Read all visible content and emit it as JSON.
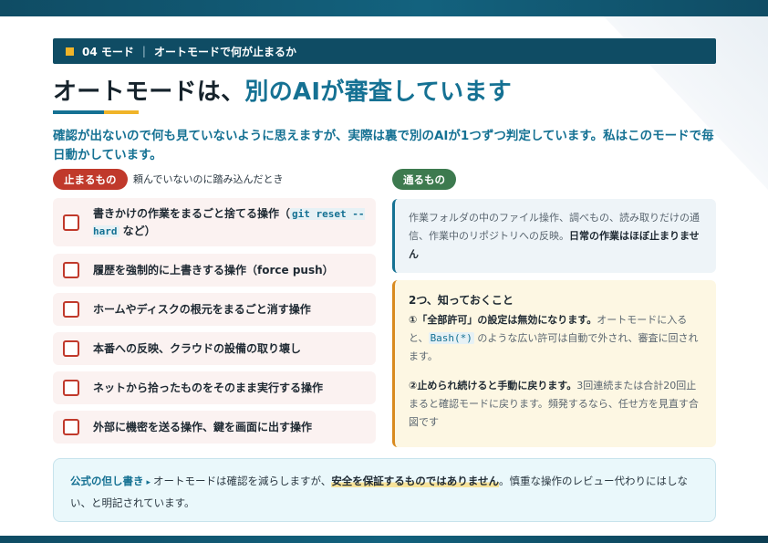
{
  "breadcrumb": {
    "section": "04 モード",
    "topic": "オートモードで何が止まるか"
  },
  "title": {
    "main": "オートモードは、",
    "accent": "別のAIが審査しています"
  },
  "lead": "確認が出ないので何も見ていないように思えますが、実際は裏で別のAIが1つずつ判定しています。私はこのモードで毎日動かしています。",
  "stop": {
    "label": "止まるもの",
    "note": "頼んでいないのに踏み込んだとき",
    "items": [
      {
        "text_before": "書きかけの作業をまるごと捨てる操作（",
        "code": "git reset --hard",
        "text_after": " など）"
      },
      {
        "text": "履歴を強制的に上書きする操作（force push）"
      },
      {
        "text": "ホームやディスクの根元をまるごと消す操作"
      },
      {
        "text": "本番への反映、クラウドの設備の取り壊し"
      },
      {
        "text": "ネットから拾ったものをそのまま実行する操作"
      },
      {
        "text": "外部に機密を送る操作、鍵を画面に出す操作"
      }
    ]
  },
  "pass": {
    "label": "通るもの",
    "body": "作業フォルダの中のファイル操作、調べもの、読み取りだけの通信、作業中のリポジトリへの反映。",
    "emphasis": "日常の作業はほぼ止まりません"
  },
  "notes": {
    "title": "2つ、知っておくこと",
    "n1_bold": "①「全部許可」の設定は無効になります。",
    "n1_text_a": "オートモードに入ると、",
    "n1_code": "Bash(*)",
    "n1_text_b": " のような広い許可は自動で外され、審査に回されます。",
    "n2_bold": "②止められ続けると手動に戻ります。",
    "n2_text": "3回連続または合計20回止まると確認モードに戻ります。頻発するなら、任せ方を見直す合図です"
  },
  "footer": {
    "label": "公式の但し書き",
    "arrow": "▸",
    "text_a": "オートモードは確認を減らしますが、",
    "emphasis": "安全を保証するものではありません",
    "text_b": "。慎重な操作のレビュー代わりにはしない、と明記されています。"
  },
  "colors": {
    "primary": "#0f4c64",
    "accent": "#157193",
    "stop": "#c0392b",
    "pass": "#3d7a4f",
    "highlight": "#f0b429"
  }
}
